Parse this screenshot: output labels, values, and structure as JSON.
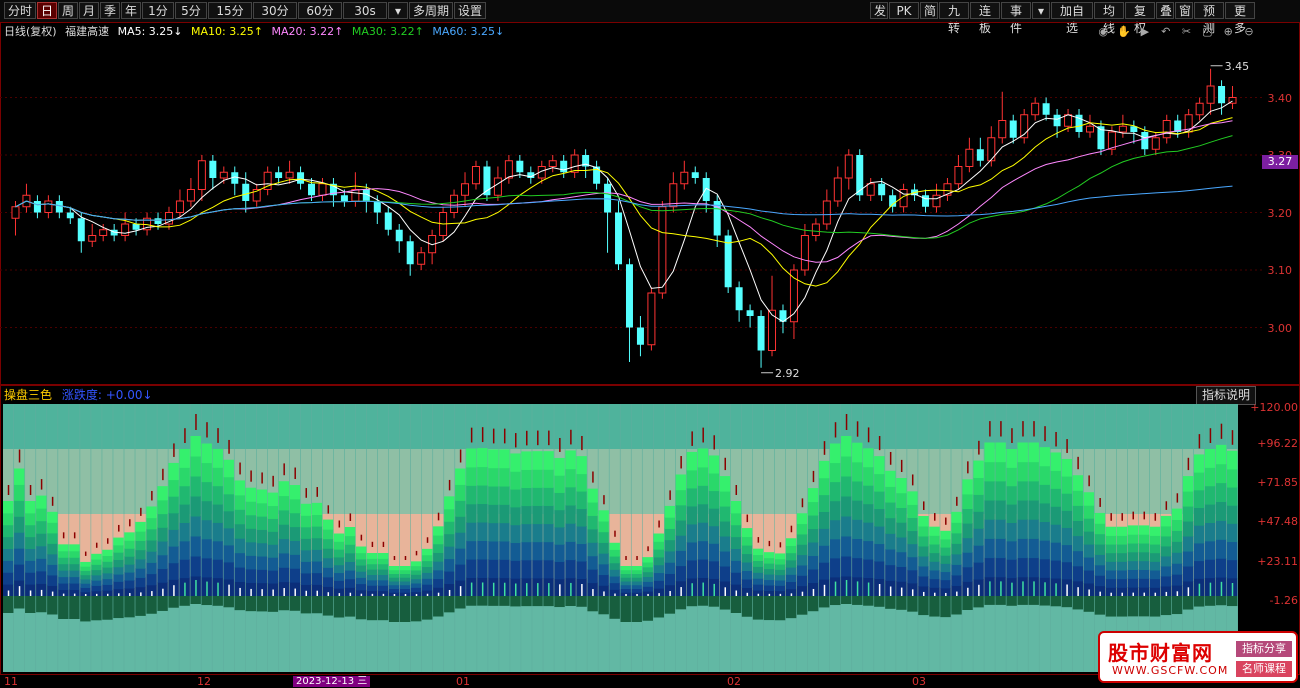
{
  "toolbar": {
    "left_items": [
      "分时",
      "日",
      "周",
      "月",
      "季",
      "年",
      "1分",
      "5分",
      "15分",
      "30分",
      "60分",
      "30s",
      "▾",
      "多周期",
      "设置"
    ],
    "active_item": "日",
    "right_items": [
      "发",
      "PK",
      "简",
      "九转",
      "连板",
      "事件",
      "▾",
      "加自选",
      "均线",
      "复权",
      "叠",
      "窗",
      "预测",
      "更多"
    ]
  },
  "ma_legend": {
    "title": "日线(复权)",
    "stock_name": "福建高速",
    "ma5": "MA5: 3.25↓",
    "ma10": "MA10: 3.25↑",
    "ma20": "MA20: 3.22↑",
    "ma30": "MA30: 3.22↑",
    "ma60": "MA60: 3.25↓"
  },
  "colors": {
    "ma5": "#ffffff",
    "ma10": "#ffff00",
    "ma20": "#ff88ff",
    "ma30": "#22cc22",
    "ma60": "#4aa8ff",
    "up": "#ff3333",
    "down": "#54ffff",
    "axis": "#d33333"
  },
  "price_axis": [
    "3.40",
    "3.30",
    "3.20",
    "3.10",
    "3.00"
  ],
  "current_price_tag": "3.27",
  "annotations": {
    "high": "3.45",
    "low": "2.92"
  },
  "indicator": {
    "title": "操盘三色",
    "sub": "涨跌度: +0.00↓",
    "button": "指标说明",
    "axis": [
      "+120.00",
      "+96.22",
      "+71.85",
      "+47.48",
      "+23.11",
      "-1.26"
    ]
  },
  "dates": {
    "labels": [
      "11",
      "12",
      "01",
      "02",
      "03"
    ],
    "selected": "2023-12-13 三"
  },
  "watermark": {
    "title": "股市财富网",
    "url": "WWW.GSCFW.COM",
    "tag1": "指标分享",
    "tag2": "名师课程"
  },
  "chart_data": {
    "type": "candlestick",
    "price_range": [
      2.9,
      3.5
    ],
    "candles": [
      [
        3.19,
        3.21,
        3.16,
        3.22
      ],
      [
        3.21,
        3.23,
        3.2,
        3.25
      ],
      [
        3.22,
        3.2,
        3.19,
        3.23
      ],
      [
        3.2,
        3.22,
        3.19,
        3.23
      ],
      [
        3.22,
        3.2,
        3.19,
        3.23
      ],
      [
        3.2,
        3.19,
        3.18,
        3.21
      ],
      [
        3.19,
        3.15,
        3.13,
        3.2
      ],
      [
        3.15,
        3.16,
        3.14,
        3.18
      ],
      [
        3.16,
        3.17,
        3.15,
        3.18
      ],
      [
        3.17,
        3.16,
        3.15,
        3.18
      ],
      [
        3.16,
        3.18,
        3.15,
        3.2
      ],
      [
        3.18,
        3.17,
        3.16,
        3.19
      ],
      [
        3.17,
        3.19,
        3.16,
        3.2
      ],
      [
        3.19,
        3.18,
        3.17,
        3.2
      ],
      [
        3.18,
        3.2,
        3.17,
        3.21
      ],
      [
        3.2,
        3.22,
        3.19,
        3.24
      ],
      [
        3.22,
        3.24,
        3.21,
        3.26
      ],
      [
        3.24,
        3.29,
        3.22,
        3.3
      ],
      [
        3.29,
        3.26,
        3.24,
        3.3
      ],
      [
        3.26,
        3.27,
        3.25,
        3.28
      ],
      [
        3.27,
        3.25,
        3.23,
        3.28
      ],
      [
        3.25,
        3.22,
        3.2,
        3.27
      ],
      [
        3.22,
        3.24,
        3.21,
        3.25
      ],
      [
        3.24,
        3.27,
        3.23,
        3.28
      ],
      [
        3.27,
        3.26,
        3.25,
        3.28
      ],
      [
        3.26,
        3.27,
        3.25,
        3.29
      ],
      [
        3.27,
        3.25,
        3.24,
        3.28
      ],
      [
        3.25,
        3.23,
        3.22,
        3.26
      ],
      [
        3.23,
        3.25,
        3.22,
        3.26
      ],
      [
        3.25,
        3.23,
        3.21,
        3.26
      ],
      [
        3.23,
        3.22,
        3.21,
        3.24
      ],
      [
        3.22,
        3.24,
        3.21,
        3.27
      ],
      [
        3.24,
        3.22,
        3.2,
        3.25
      ],
      [
        3.22,
        3.2,
        3.18,
        3.23
      ],
      [
        3.2,
        3.17,
        3.16,
        3.21
      ],
      [
        3.17,
        3.15,
        3.13,
        3.18
      ],
      [
        3.15,
        3.11,
        3.09,
        3.16
      ],
      [
        3.11,
        3.13,
        3.1,
        3.14
      ],
      [
        3.13,
        3.16,
        3.11,
        3.17
      ],
      [
        3.16,
        3.2,
        3.15,
        3.21
      ],
      [
        3.2,
        3.23,
        3.19,
        3.24
      ],
      [
        3.23,
        3.25,
        3.21,
        3.27
      ],
      [
        3.25,
        3.28,
        3.24,
        3.29
      ],
      [
        3.28,
        3.23,
        3.22,
        3.29
      ],
      [
        3.23,
        3.26,
        3.22,
        3.28
      ],
      [
        3.26,
        3.29,
        3.25,
        3.3
      ],
      [
        3.29,
        3.27,
        3.26,
        3.3
      ],
      [
        3.27,
        3.26,
        3.25,
        3.28
      ],
      [
        3.26,
        3.28,
        3.25,
        3.29
      ],
      [
        3.28,
        3.29,
        3.27,
        3.3
      ],
      [
        3.29,
        3.27,
        3.26,
        3.3
      ],
      [
        3.27,
        3.3,
        3.26,
        3.31
      ],
      [
        3.3,
        3.28,
        3.26,
        3.31
      ],
      [
        3.28,
        3.25,
        3.24,
        3.29
      ],
      [
        3.25,
        3.2,
        3.13,
        3.26
      ],
      [
        3.2,
        3.11,
        3.1,
        3.22
      ],
      [
        3.11,
        3.0,
        2.94,
        3.12
      ],
      [
        3.0,
        2.97,
        2.95,
        3.02
      ],
      [
        2.97,
        3.06,
        2.96,
        3.07
      ],
      [
        3.06,
        3.21,
        3.05,
        3.22
      ],
      [
        3.21,
        3.25,
        3.2,
        3.27
      ],
      [
        3.25,
        3.27,
        3.24,
        3.29
      ],
      [
        3.27,
        3.26,
        3.25,
        3.28
      ],
      [
        3.26,
        3.22,
        3.2,
        3.27
      ],
      [
        3.22,
        3.16,
        3.14,
        3.23
      ],
      [
        3.16,
        3.07,
        3.06,
        3.17
      ],
      [
        3.07,
        3.03,
        3.01,
        3.08
      ],
      [
        3.03,
        3.02,
        3.0,
        3.04
      ],
      [
        3.02,
        2.96,
        2.93,
        3.03
      ],
      [
        2.96,
        3.03,
        2.95,
        3.09
      ],
      [
        3.03,
        3.01,
        2.99,
        3.04
      ],
      [
        3.01,
        3.1,
        2.98,
        3.11
      ],
      [
        3.1,
        3.16,
        3.09,
        3.18
      ],
      [
        3.16,
        3.18,
        3.15,
        3.19
      ],
      [
        3.18,
        3.22,
        3.17,
        3.24
      ],
      [
        3.22,
        3.26,
        3.21,
        3.28
      ],
      [
        3.26,
        3.3,
        3.24,
        3.31
      ],
      [
        3.3,
        3.23,
        3.22,
        3.31
      ],
      [
        3.23,
        3.25,
        3.22,
        3.26
      ],
      [
        3.25,
        3.23,
        3.22,
        3.26
      ],
      [
        3.23,
        3.21,
        3.2,
        3.24
      ],
      [
        3.21,
        3.24,
        3.2,
        3.25
      ],
      [
        3.24,
        3.23,
        3.22,
        3.25
      ],
      [
        3.23,
        3.21,
        3.2,
        3.24
      ],
      [
        3.21,
        3.23,
        3.2,
        3.25
      ],
      [
        3.23,
        3.25,
        3.22,
        3.26
      ],
      [
        3.25,
        3.28,
        3.24,
        3.3
      ],
      [
        3.28,
        3.31,
        3.27,
        3.33
      ],
      [
        3.31,
        3.29,
        3.28,
        3.33
      ],
      [
        3.29,
        3.33,
        3.28,
        3.35
      ],
      [
        3.33,
        3.36,
        3.32,
        3.41
      ],
      [
        3.36,
        3.33,
        3.32,
        3.37
      ],
      [
        3.33,
        3.37,
        3.32,
        3.38
      ],
      [
        3.37,
        3.39,
        3.36,
        3.4
      ],
      [
        3.39,
        3.37,
        3.36,
        3.4
      ],
      [
        3.37,
        3.35,
        3.33,
        3.38
      ],
      [
        3.35,
        3.37,
        3.34,
        3.38
      ],
      [
        3.37,
        3.34,
        3.33,
        3.38
      ],
      [
        3.34,
        3.35,
        3.33,
        3.37
      ],
      [
        3.35,
        3.31,
        3.3,
        3.36
      ],
      [
        3.31,
        3.34,
        3.3,
        3.35
      ],
      [
        3.34,
        3.35,
        3.33,
        3.37
      ],
      [
        3.35,
        3.34,
        3.32,
        3.36
      ],
      [
        3.34,
        3.31,
        3.3,
        3.35
      ],
      [
        3.31,
        3.33,
        3.3,
        3.34
      ],
      [
        3.33,
        3.36,
        3.32,
        3.37
      ],
      [
        3.36,
        3.34,
        3.33,
        3.37
      ],
      [
        3.34,
        3.37,
        3.33,
        3.38
      ],
      [
        3.37,
        3.39,
        3.36,
        3.4
      ],
      [
        3.39,
        3.42,
        3.37,
        3.45
      ],
      [
        3.42,
        3.39,
        3.37,
        3.43
      ],
      [
        3.39,
        3.4,
        3.38,
        3.42
      ]
    ]
  }
}
